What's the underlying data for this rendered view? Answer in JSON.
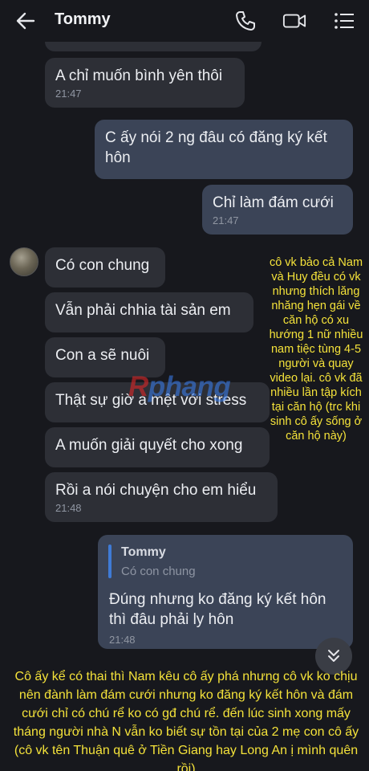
{
  "header": {
    "contact_name": "Tommy",
    "icons": [
      "back-arrow-icon",
      "phone-icon",
      "video-camera-icon",
      "menu-list-icon"
    ]
  },
  "messages": [
    {
      "side": "in",
      "text": "A chỉ muốn bình yên thôi",
      "time": "21:47"
    },
    {
      "side": "out",
      "text": "C ấy nói 2 ng đâu có đăng ký kết hôn",
      "time": ""
    },
    {
      "side": "out",
      "text": "Chỉ làm đám cưới",
      "time": "21:47"
    },
    {
      "side": "in",
      "text": "Có con chung",
      "time": ""
    },
    {
      "side": "in",
      "text": "Vẫn phải chhia tài sản em",
      "time": ""
    },
    {
      "side": "in",
      "text": "Con a sẽ nuôi",
      "time": ""
    },
    {
      "side": "in",
      "text": "Thật sự giờ a mệt với stress",
      "time": ""
    },
    {
      "side": "in",
      "text": "A muốn giải quyết cho xong",
      "time": ""
    },
    {
      "side": "in",
      "text": "Rồi a nói chuyện cho em hiểu",
      "time": "21:48"
    }
  ],
  "reply": {
    "quoted_name": "Tommy",
    "quoted_text": "Có con chung",
    "text": "Đúng nhưng ko đăng ký kết hôn thì đâu phải ly hôn",
    "time": "21:48"
  },
  "side_annotation": "cô vk bảo cả Nam và Huy đều có vk nhưng thích lăng nhăng hẹn gái về căn hộ có xu hướng 1 nữ nhiều nam tiệc tùng 4-5 người và quay video lại. cô vk đã nhiều lần tập kích tại căn hộ (trc khi sinh cô ấy sống ở căn hộ này)",
  "bottom_annotation": "Cô ấy kể có thai thì Nam kêu cô ấy phá nhưng cô vk ko chịu nên đành làm đám cưới nhưng ko đăng ký kết hôn và đám cưới chỉ có chú rể ko có gđ chú rể. đến lúc sinh xong mấy tháng người nhà N vẫn ko biết sự tồn tại của 2 mẹ con cô ấy (cô vk tên Thuận quê ở Tiền Giang hay Long An ị mình quên rồi)",
  "watermark": {
    "first": "R",
    "rest": "phang"
  },
  "colors": {
    "background": "#17181d",
    "incoming_bubble": "#2d2f36",
    "outgoing_bubble": "#3b4457",
    "annotation": "#f4e23a",
    "quote_bar": "#3f7bd6"
  }
}
